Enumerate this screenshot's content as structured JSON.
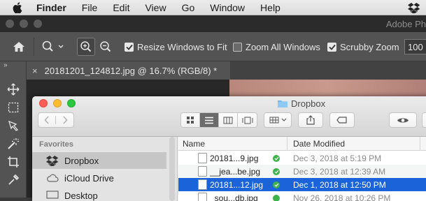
{
  "menubar": {
    "app_name": "Finder",
    "items": [
      "File",
      "Edit",
      "View",
      "Go",
      "Window",
      "Help"
    ]
  },
  "photoshop": {
    "app_title": "Adobe Ph",
    "options": {
      "resize_windows": "Resize Windows to Fit",
      "resize_checked": true,
      "zoom_all": "Zoom All Windows",
      "zoom_all_checked": false,
      "scrubby": "Scrubby Zoom",
      "scrubby_checked": true,
      "zoom_value": "100"
    },
    "doc_tab": {
      "close": "×",
      "title": "20181201_124812.jpg @ 16.7% (RGB/8) *"
    },
    "panel_toggle": "»"
  },
  "finder": {
    "title": "Dropbox",
    "sidebar": {
      "heading": "Favorites",
      "items": [
        {
          "label": "Dropbox",
          "icon": "dropbox-icon",
          "selected": true
        },
        {
          "label": "iCloud Drive",
          "icon": "cloud-icon",
          "selected": false
        },
        {
          "label": "Desktop",
          "icon": "desktop-icon",
          "selected": false
        }
      ]
    },
    "columns": {
      "name": "Name",
      "date": "Date Modified"
    },
    "files": [
      {
        "name": "20181...9.jpg",
        "date": "Dec 3, 2018 at 5:19 PM",
        "selected": false
      },
      {
        "name": "__jea...be.jpg",
        "date": "Dec 3, 2018 at 12:39 AM",
        "selected": false
      },
      {
        "name": "20181...12.jpg",
        "date": "Dec 1, 2018 at 12:50 PM",
        "selected": true
      },
      {
        "name": "_sou...db.jpg",
        "date": "Nov 26, 2018 at 10:26 PM",
        "selected": false
      }
    ]
  },
  "colors": {
    "selection_blue": "#1a63d9",
    "sync_green": "#3cb44a",
    "ps_dark": "#535353"
  }
}
